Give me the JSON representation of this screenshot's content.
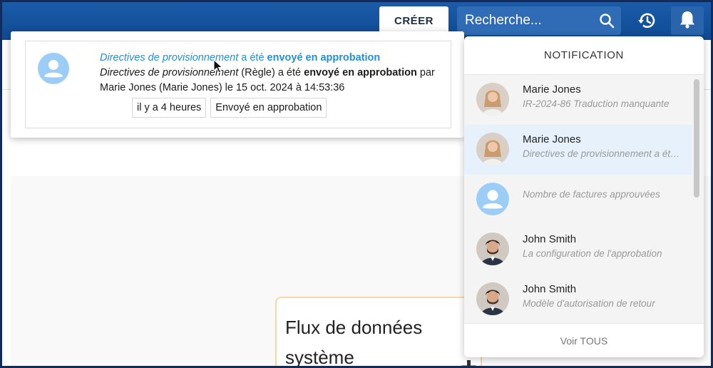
{
  "topbar": {
    "create_label": "CRÉER",
    "search_placeholder": "Recherche..."
  },
  "popup": {
    "line1_item": "Directives de provisionnement",
    "line1_mid": " a été ",
    "line1_status": "envoyé en approbation",
    "line2_item": "Directives de provisionnement",
    "line2_type": " (Règle) a été ",
    "line2_status": "envoyé en approbation",
    "line2_suffix": " par",
    "line3": "Marie Jones (Marie Jones) le 15 oct. 2024 à 14:53:36",
    "tag_time": "il y a 4 heures",
    "tag_status": "Envoyé en approbation"
  },
  "panel": {
    "title": "NOTIFICATION",
    "footer": "Voir TOUS",
    "items": [
      {
        "name": "Marie Jones",
        "desc": "IR-2024-86 Traduction manquante",
        "avatar": "woman-photo"
      },
      {
        "name": "Marie Jones",
        "desc": "Directives de provisionnement a été envoyé en approbation",
        "avatar": "woman-photo"
      },
      {
        "name": "",
        "desc": "Nombre de factures approuvées",
        "avatar": "default-avatar"
      },
      {
        "name": "John Smith",
        "desc": "La configuration de l'approbation",
        "avatar": "man-photo"
      },
      {
        "name": "John Smith",
        "desc": "Modèle d'autorisation de retour",
        "avatar": "man-photo"
      }
    ]
  },
  "canvas": {
    "flow_title_line1": "Flux de données",
    "flow_title_line2": "système"
  },
  "colors": {
    "header": "#1a5ba8",
    "accent_link": "#2390d8",
    "active_item": "#e6f1fb"
  }
}
